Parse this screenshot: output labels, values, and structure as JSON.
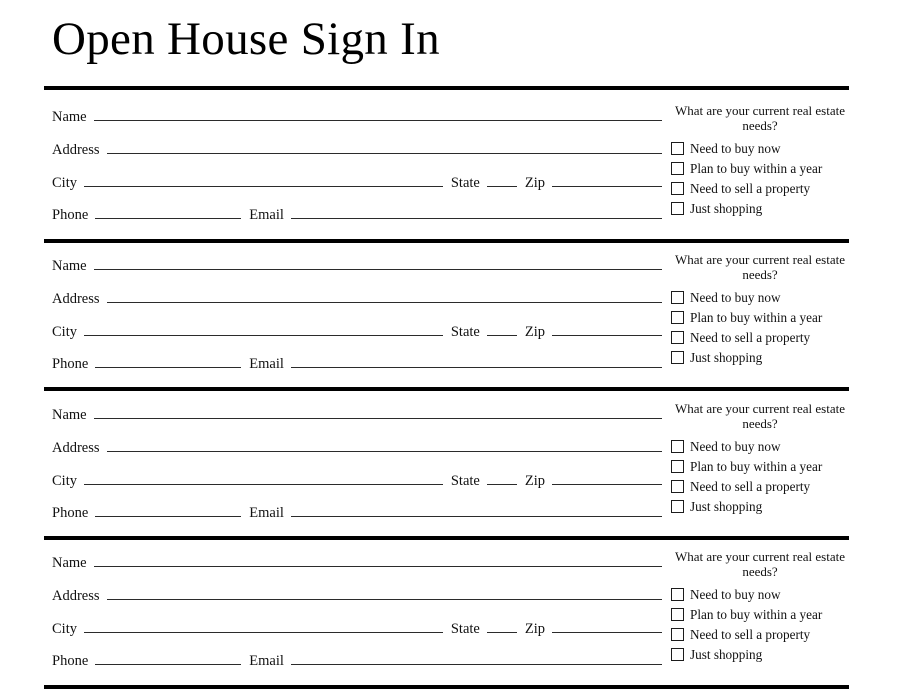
{
  "document": {
    "title": "Open House Sign In"
  },
  "form": {
    "labels": {
      "name": "Name",
      "address": "Address",
      "city": "City",
      "state": "State",
      "zip": "Zip",
      "phone": "Phone",
      "email": "Email"
    },
    "values": {
      "name": "",
      "address": "",
      "city": "",
      "state": "",
      "zip": "",
      "phone": "",
      "email": ""
    },
    "needs": {
      "heading": "What are your current real estate needs?",
      "options": [
        {
          "label": "Need to buy now",
          "checked": false
        },
        {
          "label": "Plan to buy within a year",
          "checked": false
        },
        {
          "label": "Need to sell a property",
          "checked": false
        },
        {
          "label": "Just shopping",
          "checked": false
        }
      ]
    },
    "entry_count": 4
  },
  "style": {
    "ink": "#000000",
    "line": "#2b2b2b",
    "background": "#ffffff"
  }
}
